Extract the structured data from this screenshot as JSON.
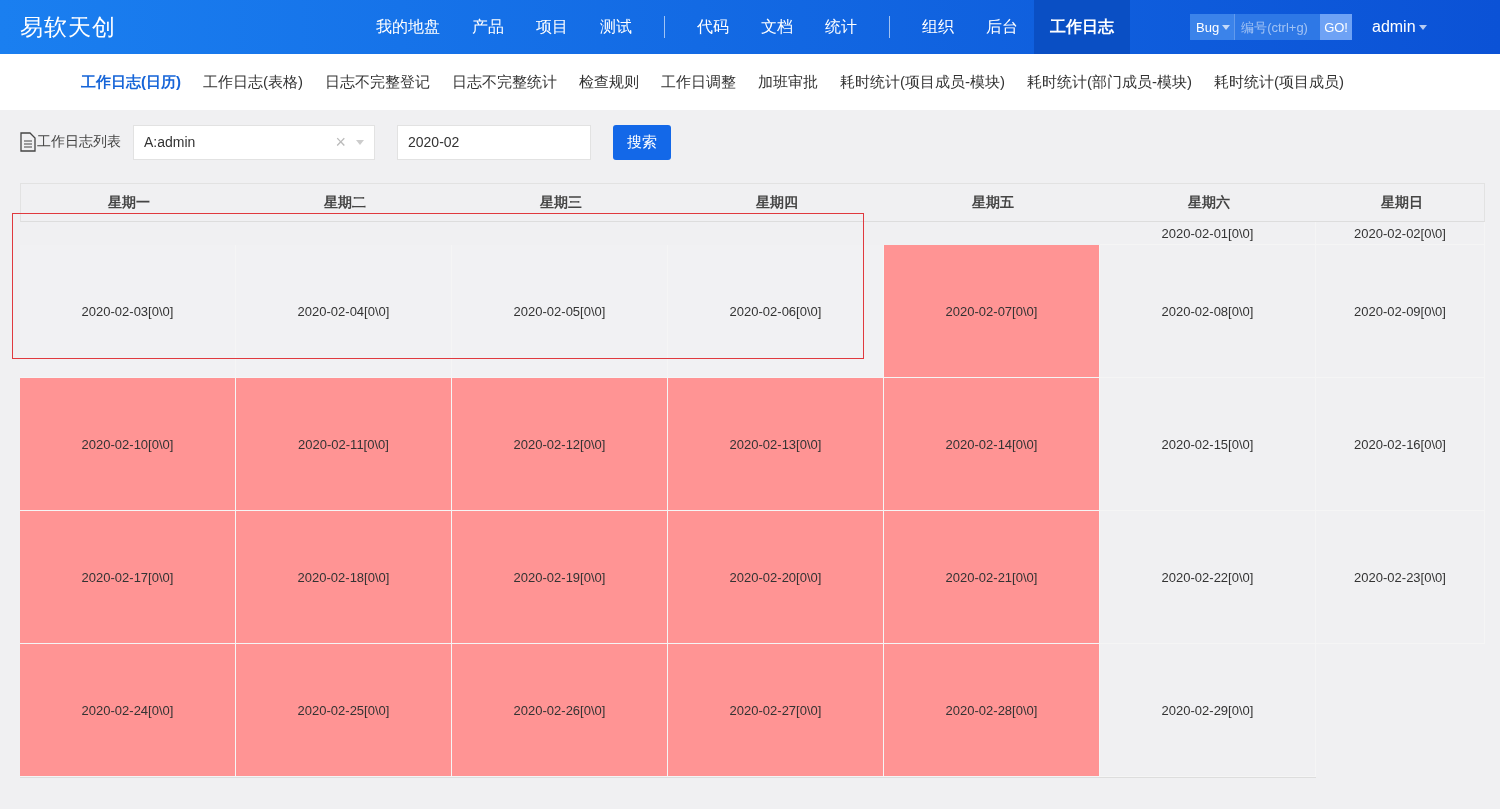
{
  "brand": "易软天创",
  "nav_groups": [
    [
      {
        "label": "我的地盘",
        "selected": false
      },
      {
        "label": "产品",
        "selected": false
      },
      {
        "label": "项目",
        "selected": false
      },
      {
        "label": "测试",
        "selected": false
      }
    ],
    [
      {
        "label": "代码",
        "selected": false
      },
      {
        "label": "文档",
        "selected": false
      },
      {
        "label": "统计",
        "selected": false
      }
    ],
    [
      {
        "label": "组织",
        "selected": false
      },
      {
        "label": "后台",
        "selected": false
      },
      {
        "label": "工作日志",
        "selected": true
      }
    ]
  ],
  "quick_search": {
    "type": "Bug",
    "placeholder": "编号(ctrl+g)",
    "button": "GO!"
  },
  "user": "admin",
  "subnav": [
    {
      "label": "工作日志(日历)",
      "selected": true
    },
    {
      "label": "工作日志(表格)",
      "selected": false
    },
    {
      "label": "日志不完整登记",
      "selected": false
    },
    {
      "label": "日志不完整统计",
      "selected": false
    },
    {
      "label": "检查规则",
      "selected": false
    },
    {
      "label": "工作日调整",
      "selected": false
    },
    {
      "label": "加班审批",
      "selected": false
    },
    {
      "label": "耗时统计(项目成员-模块)",
      "selected": false
    },
    {
      "label": "耗时统计(部门成员-模块)",
      "selected": false
    },
    {
      "label": "耗时统计(项目成员)",
      "selected": false
    }
  ],
  "filter": {
    "title": "工作日志列表",
    "user_select": "A:admin",
    "clear": "×",
    "month": "2020-02",
    "search_button": "搜索"
  },
  "calendar": {
    "weekdays": [
      "星期一",
      "星期二",
      "星期三",
      "星期四",
      "星期五",
      "星期六",
      "星期日"
    ],
    "weeks": [
      {
        "sat": {
          "date": "2020-02-01[0\\0]",
          "filled": false
        },
        "sun": {
          "date": "2020-02-02[0\\0]",
          "filled": false
        }
      },
      {
        "mon": {
          "date": "2020-02-03[0\\0]",
          "filled": false
        },
        "tue": {
          "date": "2020-02-04[0\\0]",
          "filled": false
        },
        "wed": {
          "date": "2020-02-05[0\\0]",
          "filled": false
        },
        "thu": {
          "date": "2020-02-06[0\\0]",
          "filled": false
        },
        "fri": {
          "date": "2020-02-07[0\\0]",
          "filled": true
        },
        "sat": {
          "date": "2020-02-08[0\\0]",
          "filled": false
        },
        "sun": {
          "date": "2020-02-09[0\\0]",
          "filled": false
        }
      },
      {
        "mon": {
          "date": "2020-02-10[0\\0]",
          "filled": true
        },
        "tue": {
          "date": "2020-02-11[0\\0]",
          "filled": true
        },
        "wed": {
          "date": "2020-02-12[0\\0]",
          "filled": true
        },
        "thu": {
          "date": "2020-02-13[0\\0]",
          "filled": true
        },
        "fri": {
          "date": "2020-02-14[0\\0]",
          "filled": true
        },
        "sat": {
          "date": "2020-02-15[0\\0]",
          "filled": false
        },
        "sun": {
          "date": "2020-02-16[0\\0]",
          "filled": false
        }
      },
      {
        "mon": {
          "date": "2020-02-17[0\\0]",
          "filled": true
        },
        "tue": {
          "date": "2020-02-18[0\\0]",
          "filled": true
        },
        "wed": {
          "date": "2020-02-19[0\\0]",
          "filled": true
        },
        "thu": {
          "date": "2020-02-20[0\\0]",
          "filled": true
        },
        "fri": {
          "date": "2020-02-21[0\\0]",
          "filled": true
        },
        "sat": {
          "date": "2020-02-22[0\\0]",
          "filled": false
        },
        "sun": {
          "date": "2020-02-23[0\\0]",
          "filled": false
        }
      },
      {
        "mon": {
          "date": "2020-02-24[0\\0]",
          "filled": true
        },
        "tue": {
          "date": "2020-02-25[0\\0]",
          "filled": true
        },
        "wed": {
          "date": "2020-02-26[0\\0]",
          "filled": true
        },
        "thu": {
          "date": "2020-02-27[0\\0]",
          "filled": true
        },
        "fri": {
          "date": "2020-02-28[0\\0]",
          "filled": true
        },
        "sat": {
          "date": "2020-02-29[0\\0]",
          "filled": false
        }
      }
    ]
  }
}
